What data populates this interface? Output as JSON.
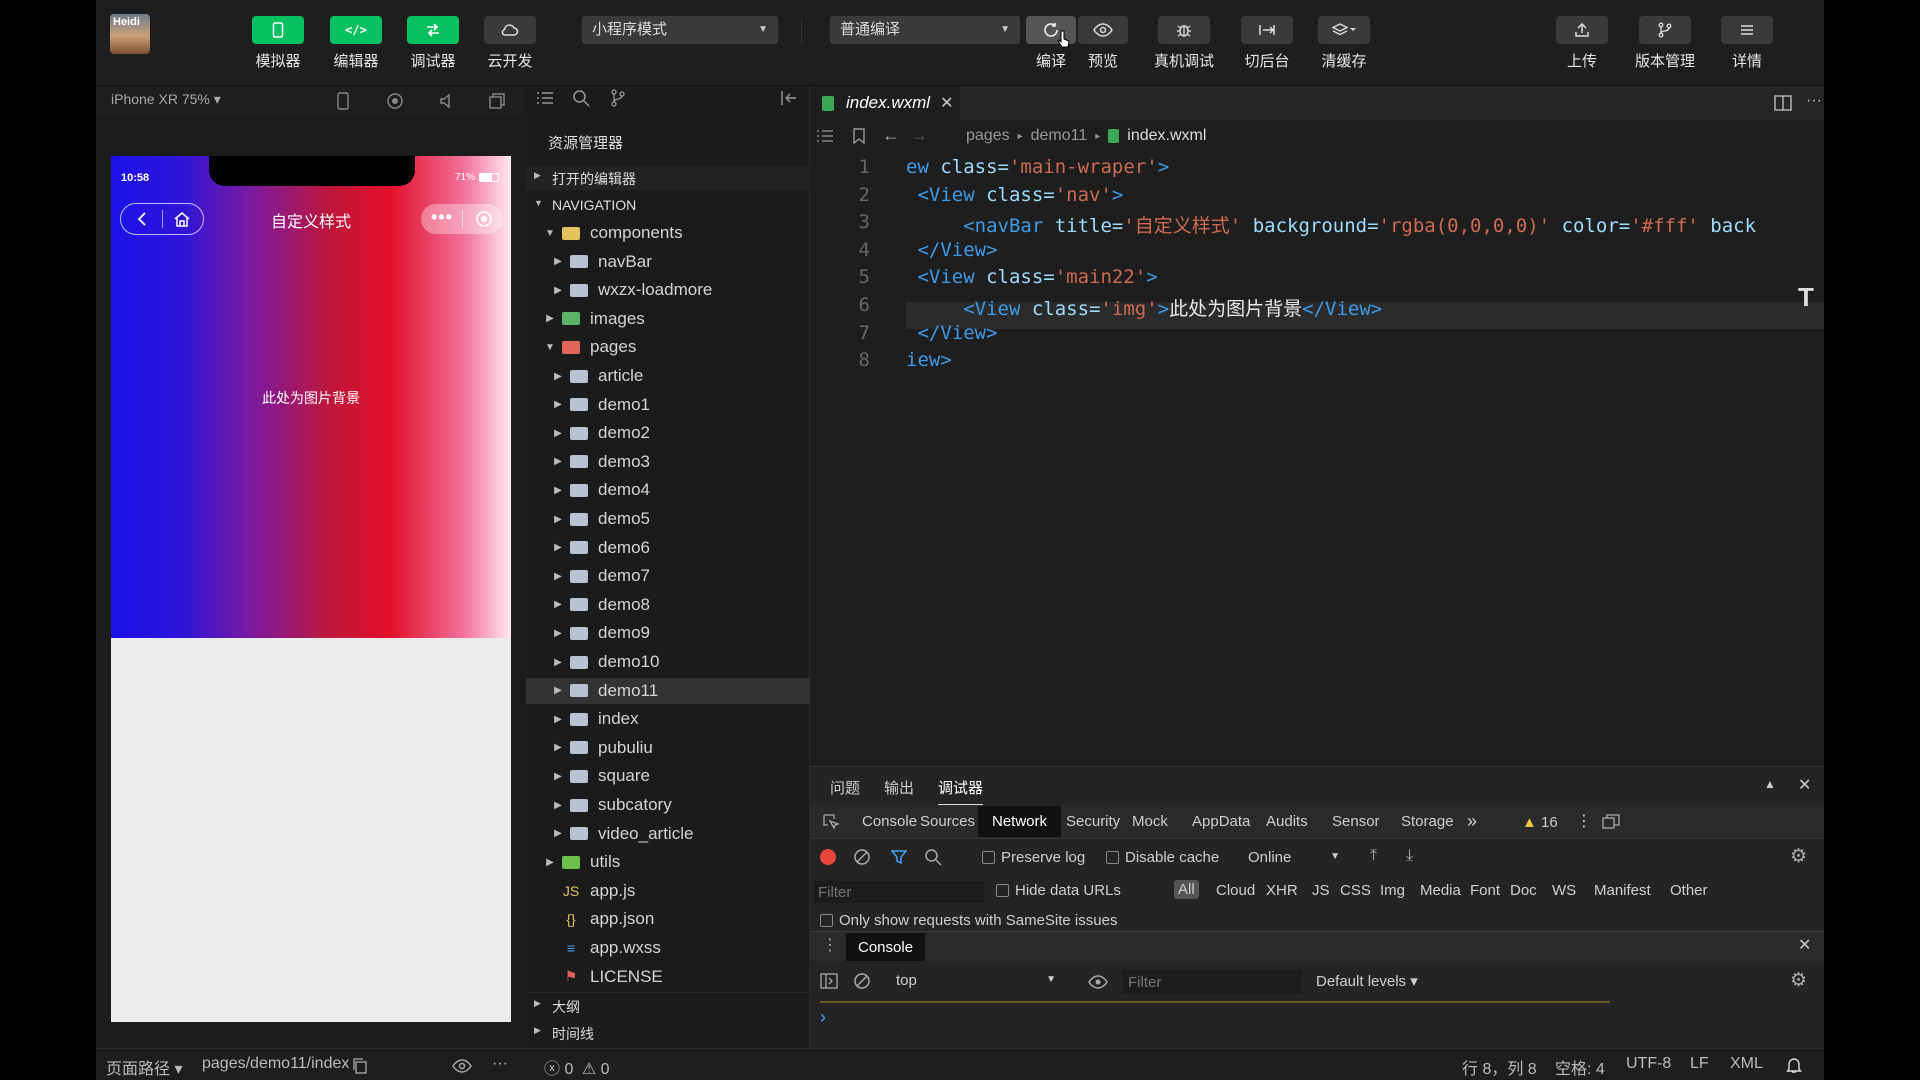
{
  "toolbar": {
    "avatar_text": "Heidi",
    "simulator": "模拟器",
    "editor": "编辑器",
    "debugger": "调试器",
    "cloud": "云开发",
    "mode": "小程序模式",
    "compile_mode": "普通编译",
    "compile": "编译",
    "preview": "预览",
    "remote_debug": "真机调试",
    "background": "切后台",
    "clear_cache": "清缓存",
    "upload": "上传",
    "version": "版本管理",
    "details": "详情"
  },
  "simulator": {
    "device": "iPhone XR 75% ▾",
    "time": "10:58",
    "battery": "71%",
    "nav_title": "自定义样式",
    "body_text": "此处为图片背景"
  },
  "explorer": {
    "title": "资源管理器",
    "open_editors": "打开的编辑器",
    "project": "NAVIGATION",
    "items": [
      {
        "label": "components",
        "kind": "folder-special",
        "depth": 1,
        "open": true
      },
      {
        "label": "navBar",
        "kind": "folder",
        "depth": 2
      },
      {
        "label": "wxzx-loadmore",
        "kind": "folder",
        "depth": 2
      },
      {
        "label": "images",
        "kind": "folder-images",
        "depth": 1
      },
      {
        "label": "pages",
        "kind": "folder-pages",
        "depth": 1,
        "open": true
      },
      {
        "label": "article",
        "kind": "folder",
        "depth": 2
      },
      {
        "label": "demo1",
        "kind": "folder",
        "depth": 2
      },
      {
        "label": "demo2",
        "kind": "folder",
        "depth": 2
      },
      {
        "label": "demo3",
        "kind": "folder",
        "depth": 2
      },
      {
        "label": "demo4",
        "kind": "folder",
        "depth": 2
      },
      {
        "label": "demo5",
        "kind": "folder",
        "depth": 2
      },
      {
        "label": "demo6",
        "kind": "folder",
        "depth": 2
      },
      {
        "label": "demo7",
        "kind": "folder",
        "depth": 2
      },
      {
        "label": "demo8",
        "kind": "folder",
        "depth": 2
      },
      {
        "label": "demo9",
        "kind": "folder",
        "depth": 2
      },
      {
        "label": "demo10",
        "kind": "folder",
        "depth": 2
      },
      {
        "label": "demo11",
        "kind": "folder",
        "depth": 2,
        "selected": true
      },
      {
        "label": "index",
        "kind": "folder",
        "depth": 2
      },
      {
        "label": "pubuliu",
        "kind": "folder",
        "depth": 2
      },
      {
        "label": "square",
        "kind": "folder",
        "depth": 2
      },
      {
        "label": "subcatory",
        "kind": "folder",
        "depth": 2
      },
      {
        "label": "video_article",
        "kind": "folder",
        "depth": 2
      },
      {
        "label": "utils",
        "kind": "folder-utils",
        "depth": 1
      },
      {
        "label": "app.js",
        "kind": "js",
        "depth": 1
      },
      {
        "label": "app.json",
        "kind": "json",
        "depth": 1
      },
      {
        "label": "app.wxss",
        "kind": "wxss",
        "depth": 1
      },
      {
        "label": "LICENSE",
        "kind": "license",
        "depth": 1
      }
    ],
    "outline": "大纲",
    "timeline": "时间线"
  },
  "editor": {
    "tab": "index.wxml",
    "breadcrumb": [
      "pages",
      "demo11",
      "index.wxml"
    ],
    "lines": [
      [
        {
          "c": "t-tag",
          "t": "ew "
        },
        {
          "c": "t-attr",
          "t": "class="
        },
        {
          "c": "t-str",
          "t": "'main-wraper'"
        },
        {
          "c": "t-tag",
          "t": ">"
        }
      ],
      [
        {
          "c": "t-tag",
          "t": " <View "
        },
        {
          "c": "t-attr",
          "t": "class="
        },
        {
          "c": "t-str",
          "t": "'nav'"
        },
        {
          "c": "t-tag",
          "t": ">"
        }
      ],
      [
        {
          "c": "t-tag",
          "t": "     <navBar "
        },
        {
          "c": "t-attr",
          "t": "title="
        },
        {
          "c": "t-str",
          "t": "'自定义样式'"
        },
        {
          "c": "t-attr",
          "t": " background="
        },
        {
          "c": "t-str",
          "t": "'rgba(0,0,0,0)'"
        },
        {
          "c": "t-attr",
          "t": " color="
        },
        {
          "c": "t-str",
          "t": "'#fff'"
        },
        {
          "c": "t-attr",
          "t": " back"
        }
      ],
      [
        {
          "c": "t-tag",
          "t": " </View>"
        }
      ],
      [
        {
          "c": "t-tag",
          "t": " <View "
        },
        {
          "c": "t-attr",
          "t": "class="
        },
        {
          "c": "t-str",
          "t": "'main22'"
        },
        {
          "c": "t-tag",
          "t": ">"
        }
      ],
      [
        {
          "c": "t-tag",
          "t": "     <View "
        },
        {
          "c": "t-attr",
          "t": "class="
        },
        {
          "c": "t-str",
          "t": "'img'"
        },
        {
          "c": "t-tag",
          "t": ">"
        },
        {
          "c": "t-txt",
          "t": "此处为图片背景"
        },
        {
          "c": "t-tag",
          "t": "</View>"
        }
      ],
      [
        {
          "c": "t-tag",
          "t": " </View>"
        }
      ],
      [
        {
          "c": "t-tag",
          "t": "iew>"
        }
      ]
    ]
  },
  "devtools": {
    "panel_tabs": [
      "问题",
      "输出",
      "调试器"
    ],
    "tabs": [
      "Console",
      "Sources",
      "Network",
      "Security",
      "Mock",
      "AppData",
      "Audits",
      "Sensor",
      "Storage"
    ],
    "more": "»",
    "warnings": "16",
    "preserve_log": "Preserve log",
    "disable_cache": "Disable cache",
    "throttle": "Online",
    "filter_placeholder": "Filter",
    "hide_data_urls": "Hide data URLs",
    "types": [
      "All",
      "Cloud",
      "XHR",
      "JS",
      "CSS",
      "Img",
      "Media",
      "Font",
      "Doc",
      "WS",
      "Manifest",
      "Other"
    ],
    "samesite": "Only show requests with SameSite issues",
    "console_title": "Console",
    "context": "top",
    "levels": "Default levels ▾",
    "prompt": "›"
  },
  "status": {
    "page_path_label": "页面路径 ▾",
    "page_path": "pages/demo11/index",
    "errors": "0",
    "warnings": "0",
    "cursor": "行 8，列 8",
    "spaces": "空格: 4",
    "encoding": "UTF-8",
    "eol": "LF",
    "lang": "XML"
  },
  "colors": {
    "brand_green": "#07c160",
    "accent_blue": "#3c9be8"
  }
}
